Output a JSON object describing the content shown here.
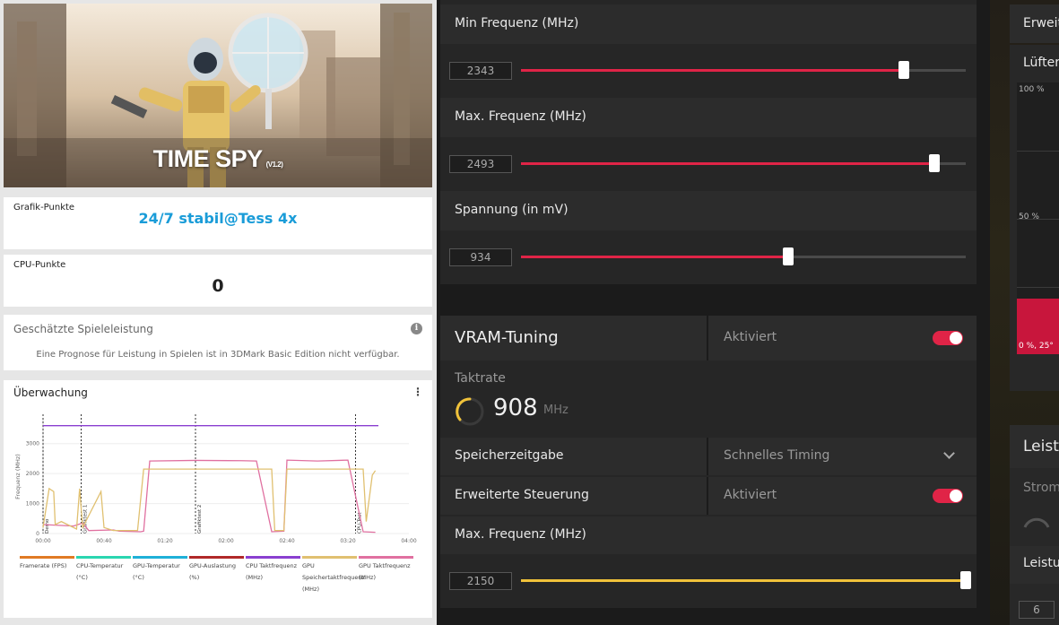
{
  "benchmark": {
    "title": "TIME SPY",
    "version": "(V1.2)",
    "graphics_label": "Grafik-Punkte",
    "graphics_value": "24/7 stabil@Tess 4x",
    "cpu_label": "CPU-Punkte",
    "cpu_value": "0",
    "estimate_title": "Geschätzte Spieleleistung",
    "estimate_note": "Eine Prognose für Leistung in Spielen ist in 3DMark Basic Edition nicht verfügbar.",
    "monitor_title": "Überwachung",
    "legend": [
      {
        "label": "Framerate (FPS)",
        "color": "#e07a24"
      },
      {
        "label": "CPU-Temperatur (°C)",
        "color": "#2ad6b0"
      },
      {
        "label": "GPU-Temperatur (°C)",
        "color": "#1fb0d8"
      },
      {
        "label": "GPU-Auslastung (%)",
        "color": "#b02828"
      },
      {
        "label": "CPU Taktfrequenz (MHz)",
        "color": "#8a3fd0"
      },
      {
        "label": "GPU Speichertaktfrequenz (MHz)",
        "color": "#e0c070"
      },
      {
        "label": "GPU Taktfrequenz (MHz)",
        "color": "#e070a0"
      }
    ]
  },
  "chart_data": {
    "type": "line",
    "ylabel": "Frequenz (MHz)",
    "ylim": [
      0,
      3800
    ],
    "yticks": [
      "3000",
      "2000",
      "1000",
      "0"
    ],
    "xticks": [
      "00:00",
      "00:40",
      "01:20",
      "02:00",
      "02:40",
      "03:20",
      "04:00"
    ],
    "markers": [
      "Demo",
      "Grafiktest 1",
      "Grafiktest 2",
      "CPU-Test"
    ],
    "series": [
      {
        "name": "CPU Taktfrequenz (MHz)",
        "color": "#8a3fd0",
        "points": [
          [
            0,
            3600
          ],
          [
            220,
            3600
          ]
        ]
      },
      {
        "name": "GPU Taktfrequenz (MHz)",
        "color": "#e070a0",
        "points": [
          [
            0,
            300
          ],
          [
            20,
            250
          ],
          [
            26,
            350
          ],
          [
            30,
            100
          ],
          [
            46,
            120
          ],
          [
            50,
            80
          ],
          [
            64,
            60
          ],
          [
            66,
            80
          ],
          [
            70,
            2420
          ],
          [
            100,
            2440
          ],
          [
            130,
            2430
          ],
          [
            140,
            2420
          ],
          [
            150,
            60
          ],
          [
            158,
            80
          ],
          [
            160,
            2450
          ],
          [
            180,
            2420
          ],
          [
            200,
            2450
          ],
          [
            210,
            60
          ],
          [
            218,
            40
          ]
        ]
      },
      {
        "name": "GPU Speichertaktfrequenz (MHz)",
        "color": "#e0c070",
        "points": [
          [
            0,
            200
          ],
          [
            4,
            1500
          ],
          [
            7,
            1400
          ],
          [
            8,
            300
          ],
          [
            12,
            400
          ],
          [
            22,
            150
          ],
          [
            24,
            1500
          ],
          [
            26,
            200
          ],
          [
            38,
            1400
          ],
          [
            40,
            200
          ],
          [
            46,
            100
          ],
          [
            62,
            100
          ],
          [
            66,
            2150
          ],
          [
            150,
            2150
          ],
          [
            152,
            100
          ],
          [
            158,
            100
          ],
          [
            160,
            2150
          ],
          [
            210,
            2150
          ],
          [
            212,
            400
          ],
          [
            216,
            1950
          ],
          [
            218,
            2100
          ]
        ]
      }
    ]
  },
  "vram_panel": {
    "min_freq_label": "Min Frequenz (MHz)",
    "min_freq_value": "2343",
    "min_freq_pct": 0.86,
    "max_freq_label": "Max. Frequenz (MHz)",
    "max_freq_value": "2493",
    "max_freq_pct": 0.93,
    "voltage_label": "Spannung (in mV)",
    "voltage_value": "934",
    "voltage_pct": 0.6,
    "section_title": "VRAM-Tuning",
    "section_state": "Aktiviert",
    "clock_label": "Taktrate",
    "clock_value": "908",
    "clock_unit": "MHz",
    "timing_label": "Speicherzeitgabe",
    "timing_value": "Schnelles Timing",
    "advanced_label": "Erweiterte Steuerung",
    "advanced_state": "Aktiviert",
    "mem_max_label": "Max. Frequenz (MHz)",
    "mem_max_value": "2150",
    "mem_max_pct": 1.0,
    "red": "#e02447",
    "yellow": "#f0c23a"
  },
  "right_panel": {
    "erweit": "Erweit",
    "luefter": "Lüfter",
    "p100": "100 %",
    "p50": "50 %",
    "p0": "0 %, 25°",
    "leist": "Leist",
    "strom": "Strom",
    "leistu": "Leistu",
    "six": "6"
  }
}
